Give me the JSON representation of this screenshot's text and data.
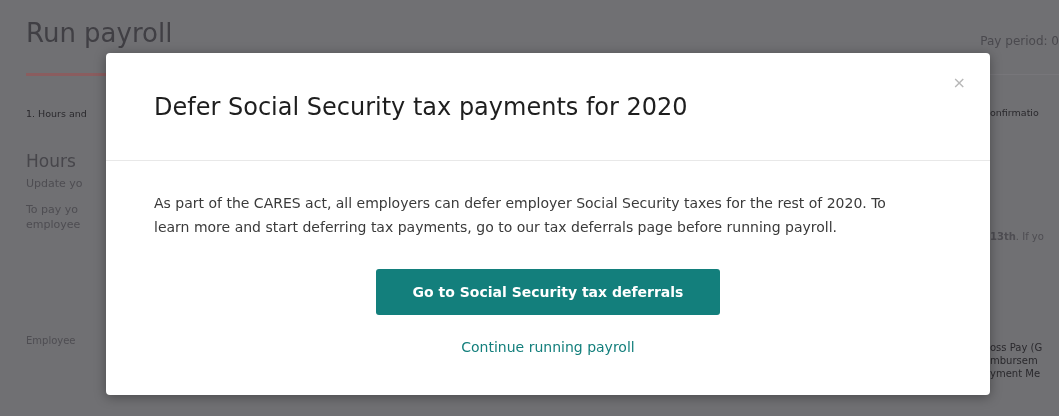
{
  "page": {
    "title": "Run payroll",
    "pay_period": "Pay period: 0",
    "step_left": "1. Hours and",
    "step_right": "onfirmatio",
    "section_title": "Hours",
    "left_lines": [
      "Update yo",
      "To pay yo",
      "employee"
    ],
    "right_note": "**13th**. If yo",
    "table_left": "Employee",
    "table_right": [
      "oss Pay (G",
      "mbursem",
      "yment Me"
    ]
  },
  "dialog": {
    "title": "Defer Social Security tax payments for 2020",
    "close": "×",
    "body": "As part of the CARES act, all employers can defer employer Social Security taxes for the rest of 2020. To learn more and start deferring tax payments, go to our tax deferrals page before running payroll.",
    "primary_button": "Go to Social Security tax deferrals",
    "link": "Continue running payroll"
  }
}
